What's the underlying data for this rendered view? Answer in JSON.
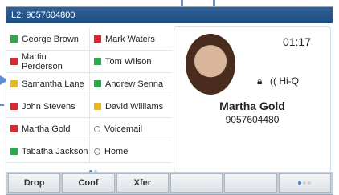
{
  "status_bar": {
    "line_label": "L2: 9057604800"
  },
  "contacts": [
    {
      "name": "George Brown",
      "status_color": "#2aa84a",
      "type": "contact"
    },
    {
      "name": "Mark Waters",
      "status_color": "#d9282f",
      "type": "contact"
    },
    {
      "name": "Martin Perderson",
      "status_color": "#d9282f",
      "type": "contact"
    },
    {
      "name": "Tom WIlson",
      "status_color": "#2aa84a",
      "type": "contact"
    },
    {
      "name": "Samantha Lane",
      "status_color": "#e6b821",
      "type": "contact"
    },
    {
      "name": "Andrew Senna",
      "status_color": "#2aa84a",
      "type": "contact"
    },
    {
      "name": "John Stevens",
      "status_color": "#d9282f",
      "type": "contact"
    },
    {
      "name": "David Williams",
      "status_color": "#e6b821",
      "type": "contact"
    },
    {
      "name": "Martha Gold",
      "status_color": "#d9282f",
      "type": "contact"
    },
    {
      "name": "Voicemail",
      "status_color": "",
      "type": "function"
    },
    {
      "name": "Tabatha Jackson",
      "status_color": "#2aa84a",
      "type": "contact"
    },
    {
      "name": "Home",
      "status_color": "",
      "type": "function"
    }
  ],
  "call": {
    "timer": "01:17",
    "audio_quality": "(( Hi-Q",
    "caller_name": "Martha Gold",
    "caller_number": "9057604480"
  },
  "softkeys": [
    {
      "label": "Drop"
    },
    {
      "label": "Conf"
    },
    {
      "label": "Xfer"
    },
    {
      "label": ""
    },
    {
      "label": ""
    },
    {
      "label": ""
    }
  ],
  "page_indicator": {
    "active_color": "#3d8bd6",
    "inactive_color": "#c7ced6"
  }
}
